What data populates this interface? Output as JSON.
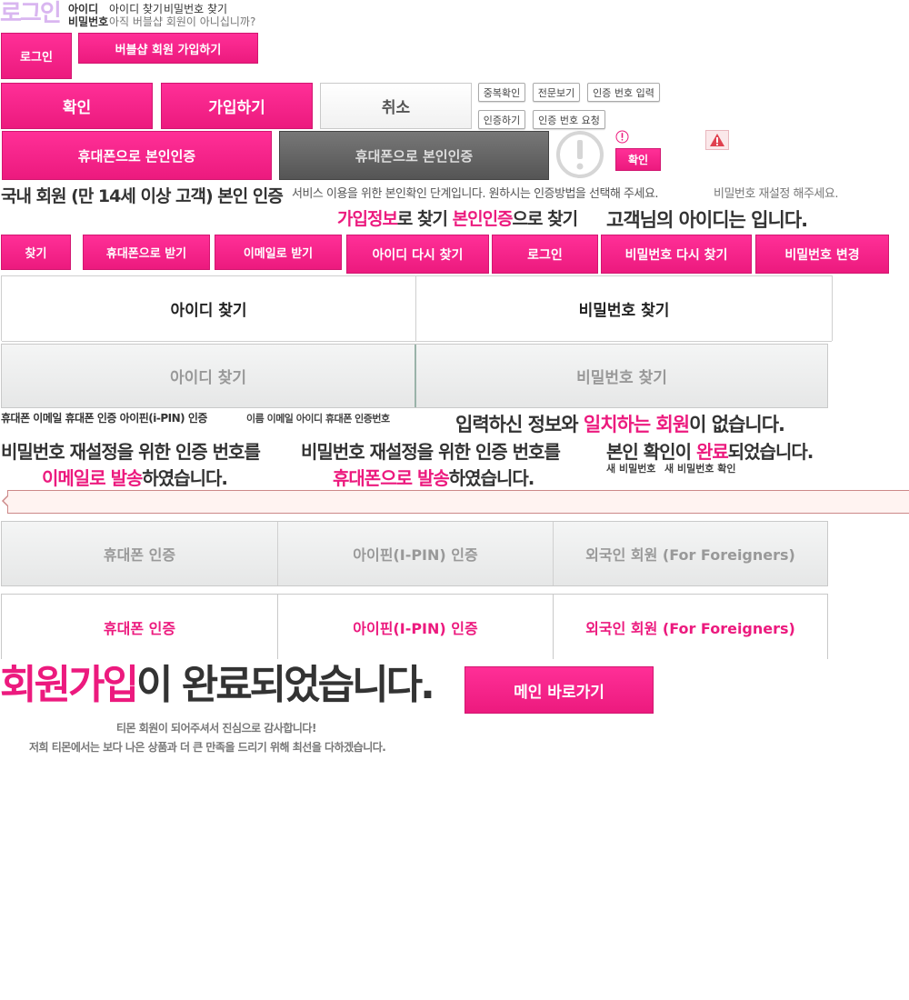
{
  "header": {
    "logo_text": "로그인",
    "label_id": "아이디",
    "label_pw": "비밀번호",
    "find_id": "아이디 찾기",
    "find_pw": "비밀번호 찾기",
    "not_member": "아직 버블샵 회원이 아니십니까?"
  },
  "buttons": {
    "login": "로그인",
    "join_bubble": "버블샵 회원 가입하기",
    "confirm": "확인",
    "join": "가입하기",
    "cancel": "취소",
    "dup_check": "중복확인",
    "view_full": "전문보기",
    "enter_code": "인증 번호 입력",
    "verify": "인증하기",
    "request_code": "인증 번호 요청",
    "phone_auth": "휴대폰으로 본인인증",
    "phone_auth_disabled": "휴대폰으로 본인인증",
    "confirm_small": "확인",
    "find": "찾기",
    "recv_phone": "휴대폰으로 받기",
    "recv_email": "이메일로 받기",
    "find_id_again": "아이디 다시 찾기",
    "login2": "로그인",
    "find_pw_again": "비밀번호 다시 찾기",
    "change_pw": "비밀번호 변경",
    "main_go": "메인 바로가기"
  },
  "texts": {
    "domestic_auth": "국내 회원 (만 14세 이상 고객) 본인 인증",
    "auth_desc": "서비스 이용을 위한 본인확인 단계입니다. 원하시는 인증방법을 선택해 주세요.",
    "reset_pw": "비밀번호 재설정 해주세요.",
    "find_by_join_a": "가입정보",
    "find_by_join_b": "로 찾기",
    "find_by_auth_a": "본인인증",
    "find_by_auth_b": "으로 찾기",
    "your_id": "고객님의 아이디는 입니다.",
    "labels_row": "휴대폰  이메일 휴대폰 인증 아이핀(i-PIN) 인증",
    "labels_row2": "이름 이메일 아이디 휴대폰  인증번호",
    "no_match_a": "입력하신 정보와 ",
    "no_match_b": "일치하는 회원",
    "no_match_c": "이 없습니다.",
    "sent_line1": "비밀번호 재설정을 위한 인증 번호를",
    "sent_email_a": "이메일로 발송",
    "sent_email_b": "하였습니다.",
    "sent_line1b": "비밀번호 재설정을 위한 인증 번호를",
    "sent_phone_a": "휴대폰으로 발송",
    "sent_phone_b": "하였습니다.",
    "auth_done_a": "본인 확인이 ",
    "auth_done_b": "완료",
    "auth_done_c": "되었습니다.",
    "new_pw": "새 비밀번호",
    "new_pw_confirm": "새 비밀번호 확인",
    "signup_done_a": "회원가입",
    "signup_done_b": "이 완료되었습니다.",
    "thanks1": "티몬 회원이 되어주셔서 진심으로 감사합니다!",
    "thanks2": "저희 티몬에서는 보다 나은 상품과 더 큰 만족을 드리기 위해 최선을 다하겠습니다."
  },
  "tabs_find_active": {
    "id": "아이디 찾기",
    "pw": "비밀번호 찾기"
  },
  "tabs_find_inactive": {
    "id": "아이디 찾기",
    "pw": "비밀번호 찾기"
  },
  "tabs_auth_inactive": [
    "휴대폰 인증",
    "아이핀(I-PIN) 인증",
    "외국인 회원 (For Foreigners)"
  ],
  "tabs_auth_active": [
    "휴대폰 인증",
    "아이핀(I-PIN) 인증",
    "외국인 회원 (For Foreigners)"
  ],
  "icons": {
    "alert_circle": "exclamation-circle-icon",
    "warning": "warning-triangle-icon",
    "small_alert": "small-exclamation-icon"
  },
  "colors": {
    "accent": "#ec1a7e",
    "text": "#333333",
    "disabled": "#666666"
  }
}
